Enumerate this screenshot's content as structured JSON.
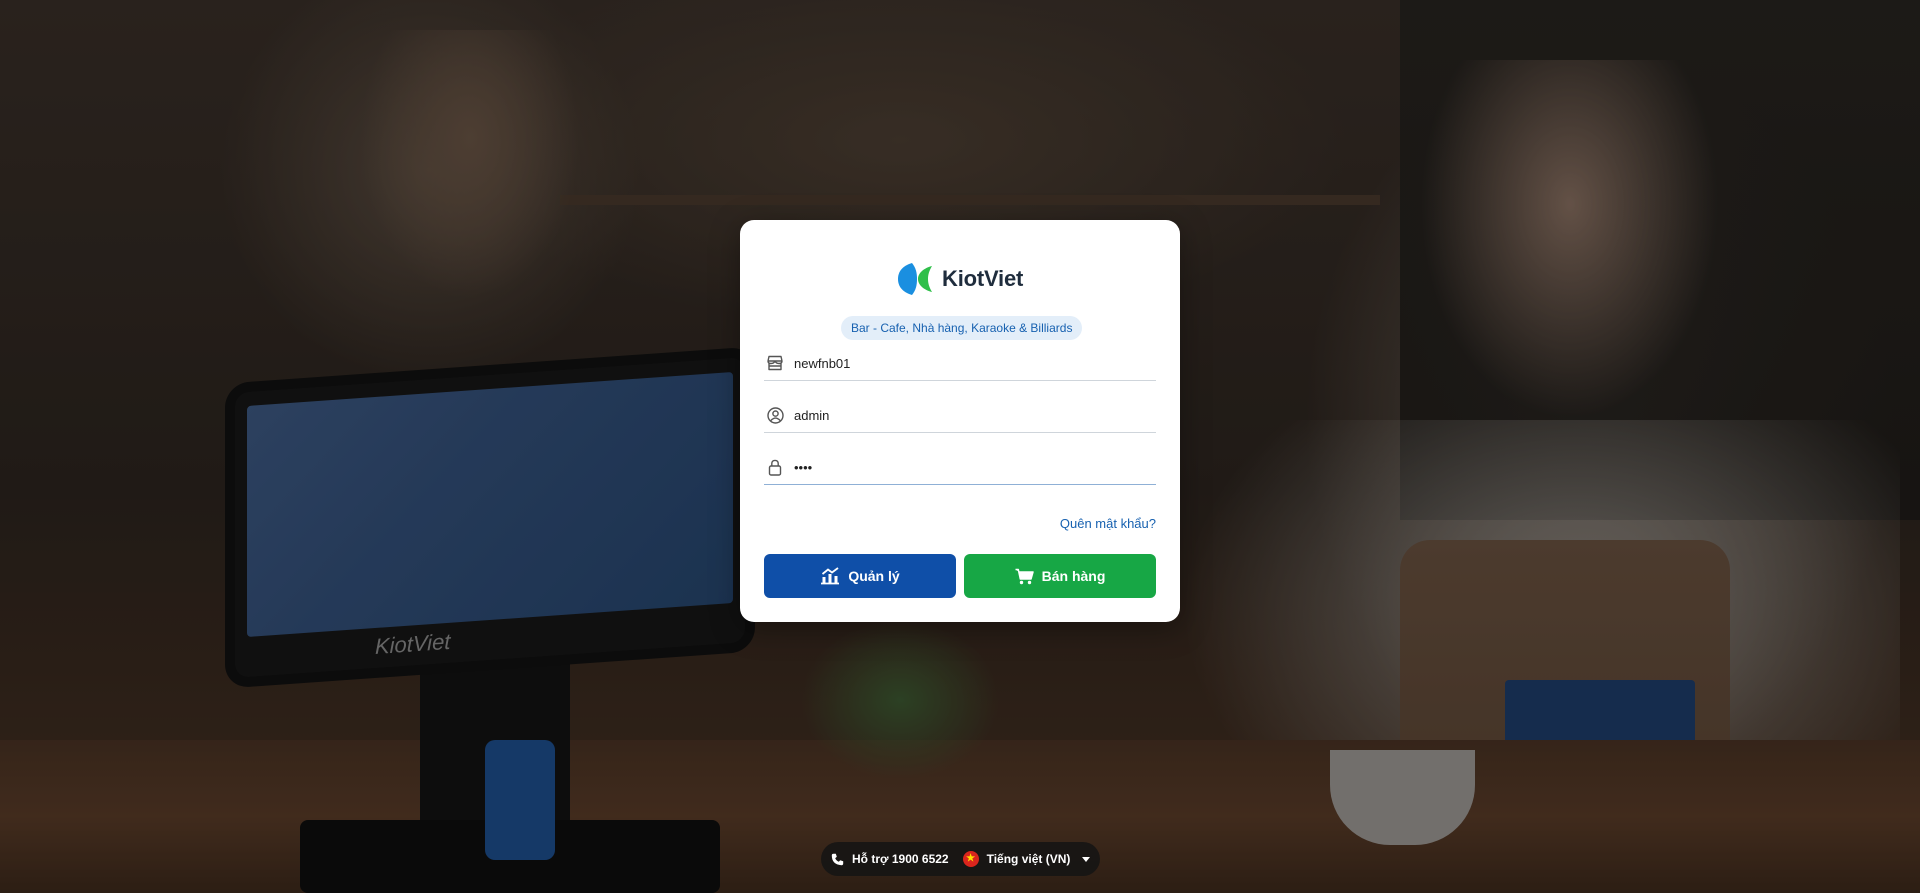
{
  "brand": {
    "name": "KiotViet",
    "tagline": "Bar - Cafe, Nhà hàng, Karaoke & Billiards",
    "background_brand_text": "KiotViet"
  },
  "form": {
    "store_value": "newfnb01",
    "username_value": "admin",
    "password_value": "••••",
    "forgot_label": "Quên mật khẩu?"
  },
  "buttons": {
    "manage_label": "Quản lý",
    "sell_label": "Bán hàng"
  },
  "footer": {
    "support_label": "Hỗ trợ 1900 6522",
    "language_label": "Tiếng việt (VN)"
  },
  "colors": {
    "primary_blue": "#0f4fa8",
    "primary_green": "#17a745",
    "link_blue": "#1761b0"
  },
  "icons": {
    "store": "store-icon",
    "user": "user-icon",
    "lock": "lock-icon",
    "chart": "chart-icon",
    "cart": "cart-icon",
    "phone": "phone-icon",
    "flag": "vietnam-flag-icon",
    "caret": "caret-down-icon"
  }
}
